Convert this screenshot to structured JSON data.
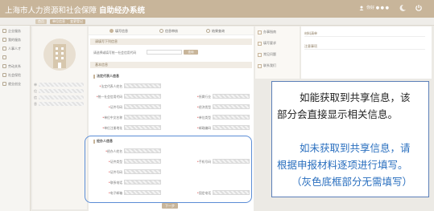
{
  "header": {
    "title_prefix": "上海市人力资源和社会保障",
    "title_main": "自助经办系统",
    "user_text": "你好 ● ● ●",
    "brand_color": "#c8b59a"
  },
  "subbar": {
    "crumbs": [
      "首页",
      "单位信息",
      "变更登记"
    ]
  },
  "leftnav": {
    "items": [
      {
        "label": "企业服务",
        "icon": "building-icon"
      },
      {
        "label": "我的服务",
        "icon": "user-icon"
      },
      {
        "label": "人事人才",
        "icon": "people-icon"
      },
      {
        "label": "",
        "icon": "grid-icon"
      },
      {
        "label": "劳动关系",
        "icon": "handshake-icon"
      },
      {
        "label": "社会保险",
        "icon": "shield-icon"
      },
      {
        "label": "就业创业",
        "icon": "briefcase-icon"
      }
    ]
  },
  "profile": {
    "lines": [
      "单",
      "位",
      "信",
      "息"
    ]
  },
  "tabs": [
    {
      "label": "填写信息",
      "active": true
    },
    {
      "label": "信息审核",
      "active": false
    },
    {
      "label": "结果查询",
      "active": false
    }
  ],
  "form": {
    "section1_header": "请填写下列信息",
    "query_label": "请选择或填写统一社会信用代码",
    "query_button": "查询",
    "section2_header": "基本信息",
    "subsection_a_title": "法定代表人信息",
    "subsection_a_fields": [
      {
        "label": "法定代表人姓名"
      },
      {
        "label": "统一社会信用代码"
      },
      {
        "label": "证件号码"
      },
      {
        "label": "单位中文名称"
      },
      {
        "label": "单位注册地址"
      }
    ],
    "subsection_a_right_fields": [
      {
        "label": "所属行业"
      },
      {
        "label": "经济类型"
      },
      {
        "label": "单位类型"
      },
      {
        "label": "邮政编码"
      }
    ],
    "subsection_b_title": "经办人信息",
    "subsection_b_fields": [
      {
        "label": "经办人姓名"
      },
      {
        "label": "证件类型"
      },
      {
        "label": "证件号码"
      },
      {
        "label": "联系电话"
      },
      {
        "label": "电子邮箱"
      }
    ],
    "subsection_b_right_fields": [
      {
        "label": "手机号码"
      },
      {
        "label": "固定电话"
      }
    ],
    "submit_label": "下一步"
  },
  "rightpanel": {
    "items": [
      "办事指南",
      "填写要求",
      "常见问题",
      "联系我们"
    ]
  },
  "farpanel": {
    "rows": [
      "材料清单",
      "注意事项"
    ]
  },
  "callout": {
    "line1": "如能获取到共享信息，该",
    "line2": "部分会直接显示相关信息。",
    "line3": "如未获取到共享信息，请",
    "line4": "根据申报材料逐项进行填写。",
    "line5": "（灰色底框部分无需填写）"
  }
}
